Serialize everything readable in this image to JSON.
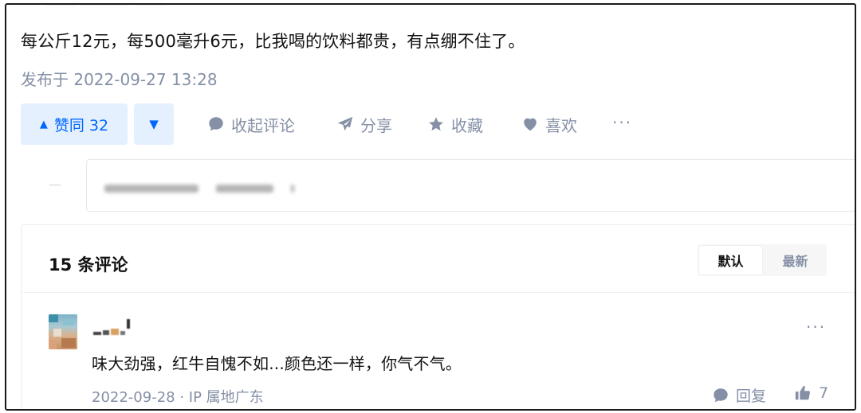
{
  "answer": {
    "content": "每公斤12元，每500毫升6元，比我喝的饮料都贵，有点绷不住了。",
    "published": "发布于 2022-09-27 13:28"
  },
  "actions": {
    "upvote_label": "赞同 32",
    "upvote_icon": "triangle-up-icon",
    "downvote_icon": "triangle-down-icon",
    "collapse_comments": "收起评论",
    "share": "分享",
    "favorite": "收藏",
    "like": "喜欢",
    "more": "···",
    "accent": "#0066ff",
    "accent_bg": "#e5f0ff"
  },
  "comments": {
    "title": "15 条评论",
    "sort": {
      "default": "默认",
      "newest": "最新",
      "selected": "默认"
    },
    "items": [
      {
        "text": "味大劲强，红牛自愧不如...颜色还一样，你气不气。",
        "date": "2022-09-28",
        "ip": "· IP 属地广东",
        "reply_label": "回复",
        "likes": "7",
        "more": "···"
      }
    ]
  }
}
